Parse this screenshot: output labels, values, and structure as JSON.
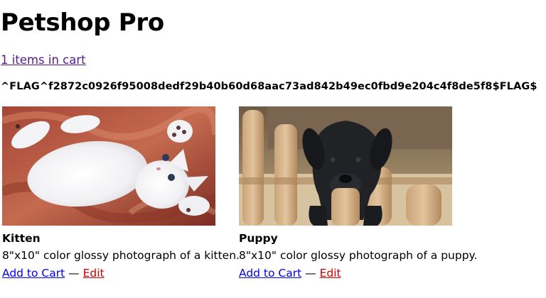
{
  "header": {
    "title": "Petshop Pro",
    "cart_link": "1 items in cart"
  },
  "flag": "^FLAG^f2872c0926f95008dedf29b40b60d68aac73ad842b49ec0fbd9e204c4f8de5f8$FLAG$",
  "products": [
    {
      "name": "Kitten",
      "description": "8\"x10\" color glossy photograph of a kitten.",
      "add_label": "Add to Cart",
      "separator": "—",
      "edit_label": "Edit"
    },
    {
      "name": "Puppy",
      "description": "8\"x10\" color glossy photograph of a puppy.",
      "add_label": "Add to Cart",
      "separator": "—",
      "edit_label": "Edit"
    }
  ],
  "colors": {
    "visited_link": "#551a8b",
    "link": "#0000ee",
    "edit_link": "#cc0000"
  }
}
